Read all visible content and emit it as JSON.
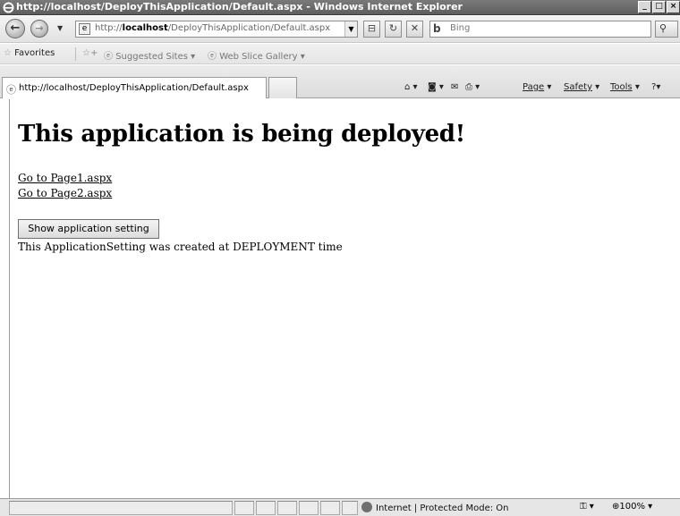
{
  "window": {
    "title": "http://localhost/DeployThisApplication/Default.aspx - Windows Internet Explorer",
    "minimize": "_",
    "maximize": "□",
    "close": "×"
  },
  "address_bar": {
    "url_prefix": "http://",
    "url_host": "localhost",
    "url_path": "/DeployThisApplication/Default.aspx"
  },
  "search": {
    "placeholder": "Bing"
  },
  "favorites_bar": {
    "favorites_label": "Favorites",
    "items": [
      "Suggested Sites ▾",
      "Web Slice Gallery ▾"
    ]
  },
  "tab": {
    "title": "http://localhost/DeployThisApplication/Default.aspx"
  },
  "command_bar": {
    "page": "Page",
    "safety": "Safety",
    "tools": "Tools"
  },
  "page": {
    "heading": "This application is being deployed!",
    "link1": "Go to Page1.aspx",
    "link2": "Go to Page2.aspx",
    "button": "Show application setting",
    "message": "This ApplicationSetting was created at DEPLOYMENT time"
  },
  "status_bar": {
    "zone": "Internet | Protected Mode: On",
    "zoom": "100%"
  }
}
